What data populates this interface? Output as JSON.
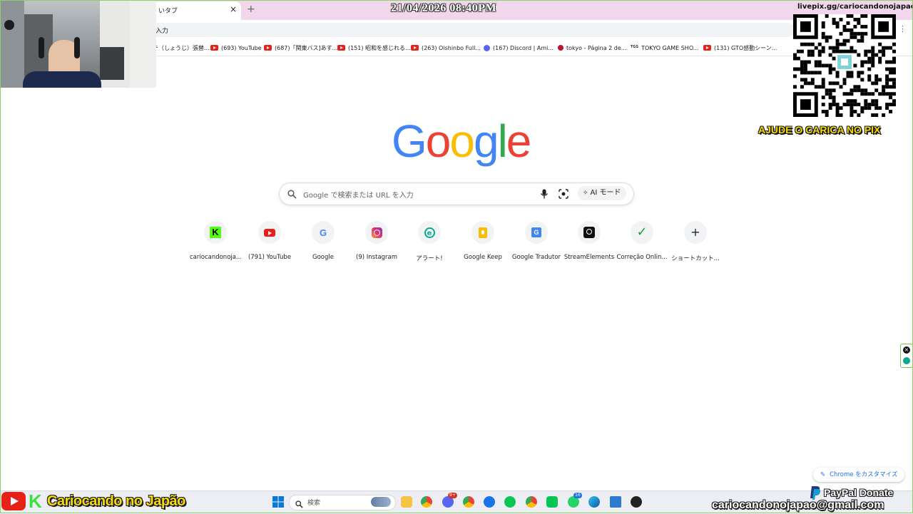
{
  "overlay": {
    "timestamp": "21/04/2026 08:40PM",
    "livepix_url": "livepix.gg/cariocandonojapao",
    "pix_text": "AJUDE O CARICA NO PIX",
    "paypal_text": "PayPal Donate",
    "email": "cariocandonojapao@gmail.com",
    "brand_k": "K",
    "brand_name": "Cariocando no Japão"
  },
  "browser": {
    "tab_title": "いタブ",
    "tab_close": "×",
    "new_tab": "+",
    "omnibox_text": "入力",
    "menu_icon": "vertical-dots-icon",
    "bookmarks": [
      {
        "label": "チ（しょうじ）張替...",
        "icon": "none"
      },
      {
        "label": "(693) YouTube",
        "icon": "youtube-icon"
      },
      {
        "label": "(687)「関東バス]あす...",
        "icon": "youtube-icon"
      },
      {
        "label": "(151) 昭和を感じれる...",
        "icon": "youtube-icon"
      },
      {
        "label": "(263) Oishinbo Full...",
        "icon": "youtube-icon"
      },
      {
        "label": "(167) Discord | Ami...",
        "icon": "discord-icon"
      },
      {
        "label": "tokyo - Página 2 de...",
        "icon": "apple-icon"
      },
      {
        "label": "TOKYO GAME SHO...",
        "icon": "tgs-icon"
      },
      {
        "label": "(131) GTO感動シーン...",
        "icon": "youtube-icon"
      }
    ]
  },
  "google": {
    "logo_letters": [
      "G",
      "o",
      "o",
      "g",
      "l",
      "e"
    ],
    "logo_colors": [
      "#4285f4",
      "#ea4335",
      "#fbbc05",
      "#4285f4",
      "#34a853",
      "#ea4335"
    ],
    "search_placeholder": "Google で検索または URL を入力",
    "ai_mode_label": "AI モード",
    "shortcuts": [
      {
        "label": "cariocandonoja...",
        "icon": "kick-icon"
      },
      {
        "label": "(791) YouTube",
        "icon": "youtube-icon"
      },
      {
        "label": "Google",
        "icon": "google-icon"
      },
      {
        "label": "(9) Instagram",
        "icon": "instagram-icon"
      },
      {
        "label": "アラート!",
        "icon": "streamelements-e-icon"
      },
      {
        "label": "Google Keep",
        "icon": "keep-icon"
      },
      {
        "label": "Google Tradutor",
        "icon": "translate-icon"
      },
      {
        "label": "StreamElements",
        "icon": "streamelements-icon"
      },
      {
        "label": "Correção Onlin...",
        "icon": "checkmark-icon"
      },
      {
        "label": "ショートカット...",
        "icon": "plus-icon"
      }
    ],
    "customize_label": "Chrome をカスタマイズ"
  },
  "taskbar": {
    "search_placeholder": "検索",
    "badges": {
      "discord": "9+",
      "whatsapp": "16"
    }
  },
  "colors": {
    "tabstrip": "#f2d6ec",
    "frame": "#8ad16a",
    "pix_yellow": "#f5d90a",
    "youtube_red": "#e62117"
  }
}
